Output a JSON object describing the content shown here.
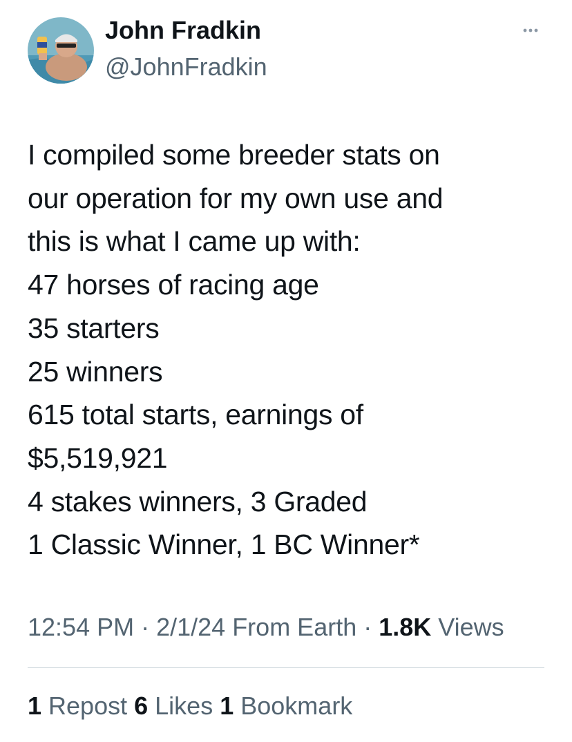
{
  "author": {
    "name": "John Fradkin",
    "handle": "@JohnFradkin"
  },
  "tweet": {
    "text": "I compiled some breeder stats on\nour operation for my own use and\nthis is what I came up with:\n47 horses of racing age\n35 starters\n25 winners\n615 total starts, earnings of\n$5,519,921\n4 stakes winners, 3 Graded\n1 Classic Winner, 1 BC Winner*"
  },
  "meta": {
    "time": "12:54 PM",
    "sep1": " · ",
    "date": "2/1/24",
    "source": " From Earth",
    "sep2": " · ",
    "views_count": "1.8K",
    "views_label": " Views"
  },
  "stats": {
    "reposts_count": "1",
    "reposts_label": " Repost",
    "likes_count": "6",
    "likes_label": " Likes",
    "bookmarks_count": "1",
    "bookmarks_label": " Bookmark"
  },
  "icons": {
    "more": "more-horizontal-icon"
  },
  "colors": {
    "text": "#0f1419",
    "secondary": "#536471",
    "divider": "#cfd9de"
  }
}
